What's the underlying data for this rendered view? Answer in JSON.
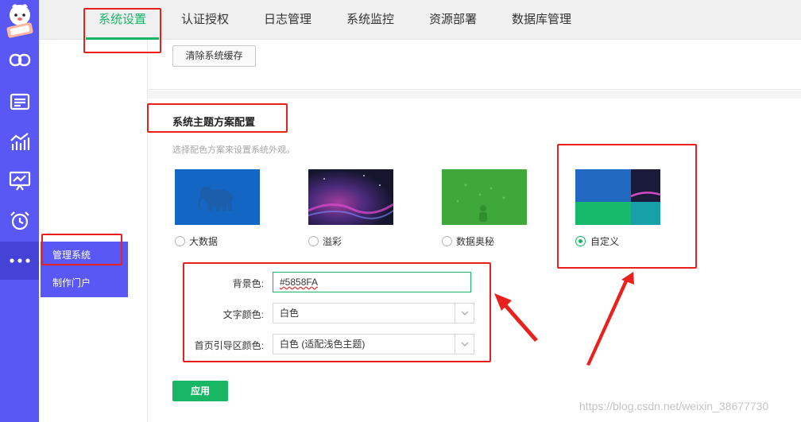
{
  "rail": {
    "icons": [
      "link-icon",
      "list-card-icon",
      "chart-icon",
      "monitor-chart-icon",
      "alarm-clock-icon",
      "more-dots-icon"
    ]
  },
  "submenu": {
    "items": [
      {
        "label": "管理系统"
      },
      {
        "label": "制作门户"
      }
    ]
  },
  "topnav": {
    "tabs": [
      {
        "label": "系统设置",
        "active": true
      },
      {
        "label": "认证授权"
      },
      {
        "label": "日志管理"
      },
      {
        "label": "系统监控"
      },
      {
        "label": "资源部署"
      },
      {
        "label": "数据库管理"
      }
    ]
  },
  "cache": {
    "clear_label": "清除系统缓存"
  },
  "theme_section": {
    "title": "系统主题方案配置",
    "description": "选择配色方案来设置系统外观。",
    "options": [
      {
        "label": "大数据",
        "checked": false
      },
      {
        "label": "溢彩",
        "checked": false
      },
      {
        "label": "数据奥秘",
        "checked": false
      },
      {
        "label": "自定义",
        "checked": true
      }
    ]
  },
  "form": {
    "bg_color": {
      "label": "背景色:",
      "value": "#5858FA"
    },
    "text_color": {
      "label": "文字颜色:",
      "value": "白色"
    },
    "guide_color": {
      "label": "首页引导区颜色:",
      "value": "白色 (适配浅色主题)"
    },
    "apply_label": "应用"
  },
  "colors": {
    "accent": "#18b566",
    "rail": "#5a58f5",
    "annotation": "#e8211d"
  },
  "watermark": "https://blog.csdn.net/weixin_38677730"
}
